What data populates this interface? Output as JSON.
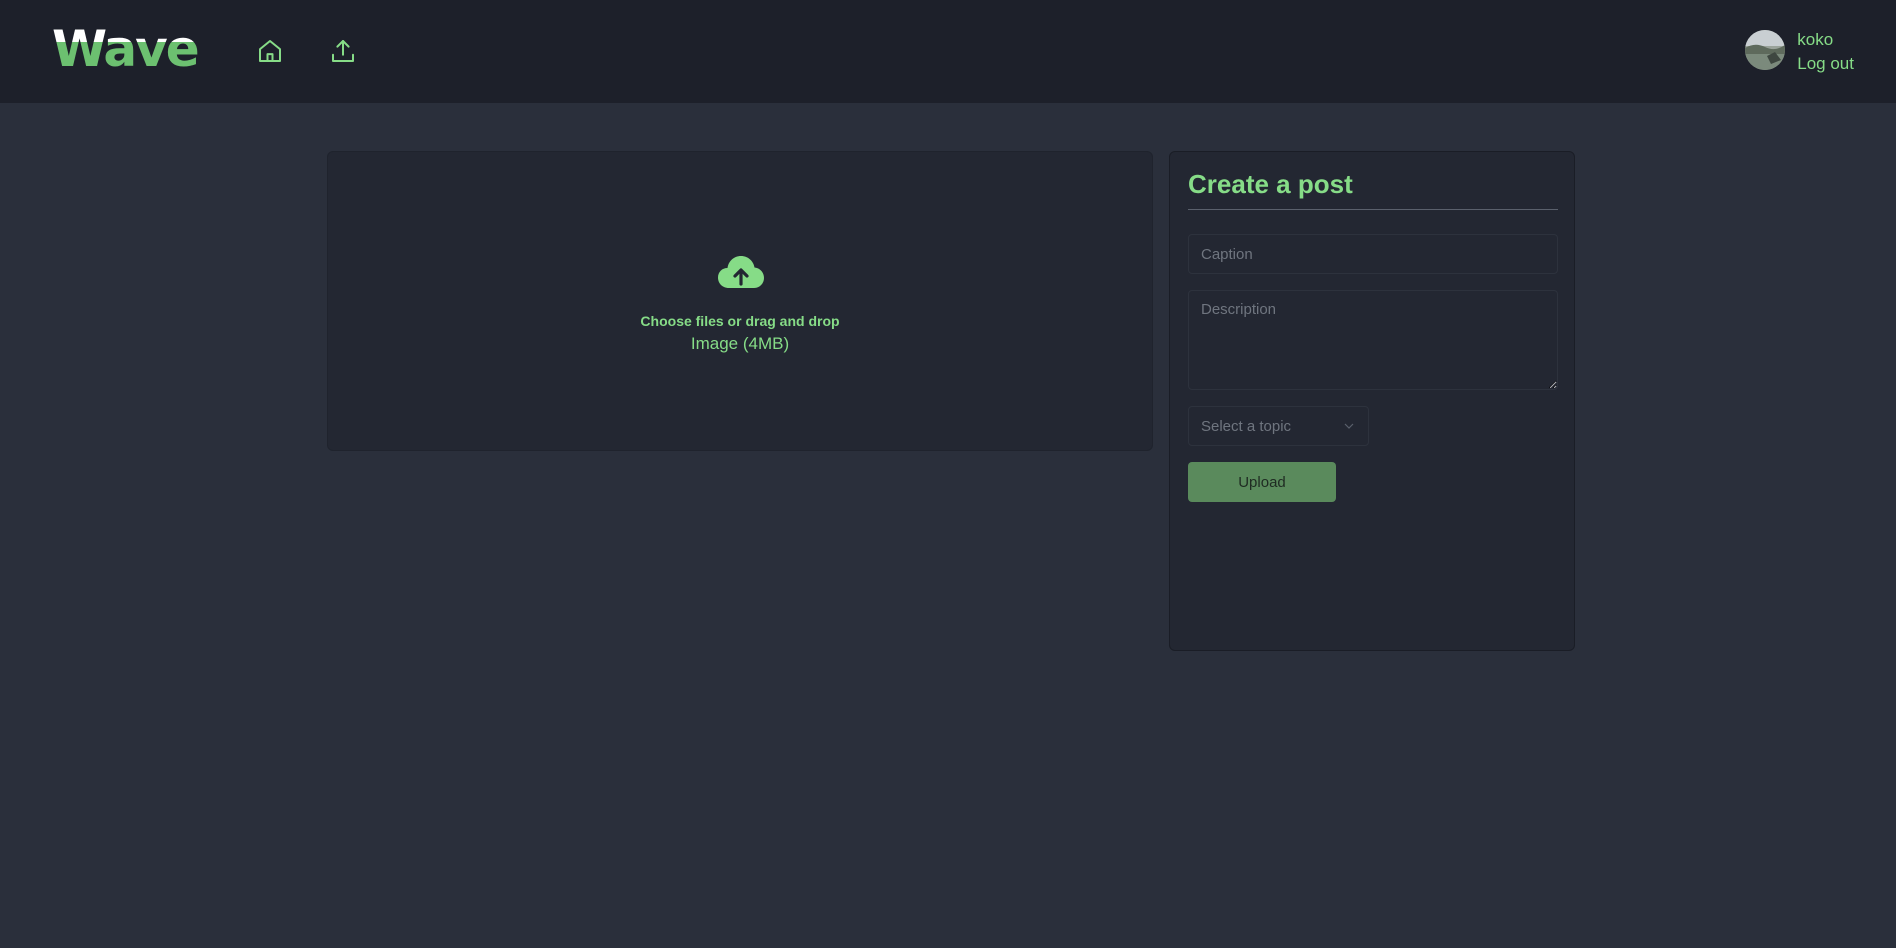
{
  "header": {
    "logo_text": "Wave",
    "nav": [
      {
        "name": "home",
        "icon": "home-icon"
      },
      {
        "name": "upload",
        "icon": "upload-icon"
      }
    ],
    "user": {
      "username": "koko",
      "logout_label": "Log out",
      "avatar_icon": "avatar-photo"
    }
  },
  "dropzone": {
    "icon": "cloud-upload-icon",
    "title": "Choose files or drag and drop",
    "subtitle": "Image (4MB)"
  },
  "form": {
    "title": "Create a post",
    "caption_placeholder": "Caption",
    "description_placeholder": "Description",
    "topic_placeholder": "Select a topic",
    "submit_label": "Upload"
  },
  "colors": {
    "accent": "#86dc87",
    "navbar_bg": "#1d202a",
    "page_bg": "#2a2f3b",
    "card_bg": "#232732",
    "button_bg": "#5a8a5c"
  }
}
